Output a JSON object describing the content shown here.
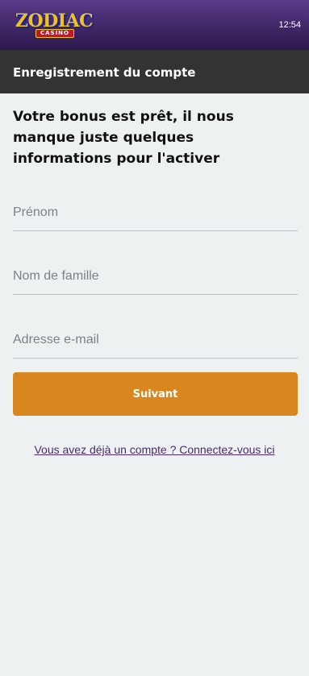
{
  "topbar": {
    "logo_text": "ZODIAC",
    "logo_subtext": "CASINO",
    "time": "12:54"
  },
  "titlebar": {
    "title": "Enregistrement du compte"
  },
  "form": {
    "heading": "Votre bonus est prêt, il nous manque juste quelques informations pour l'activer",
    "first_name": {
      "placeholder": "Prénom",
      "value": ""
    },
    "last_name": {
      "placeholder": "Nom de famille",
      "value": ""
    },
    "email": {
      "placeholder": "Adresse e-mail",
      "value": ""
    },
    "submit_label": "Suivant",
    "login_link": "Vous avez déjà un compte ? Connectez-vous ici"
  },
  "colors": {
    "header_purple": "#3f2766",
    "titlebar": "#333333",
    "background": "#edf1f2",
    "button_orange": "#d9861f",
    "link_purple": "#4a2c6b",
    "logo_gold": "#f2c21a",
    "logo_red": "#c2172b"
  },
  "icons": [
    "zodiac-casino-logo"
  ]
}
